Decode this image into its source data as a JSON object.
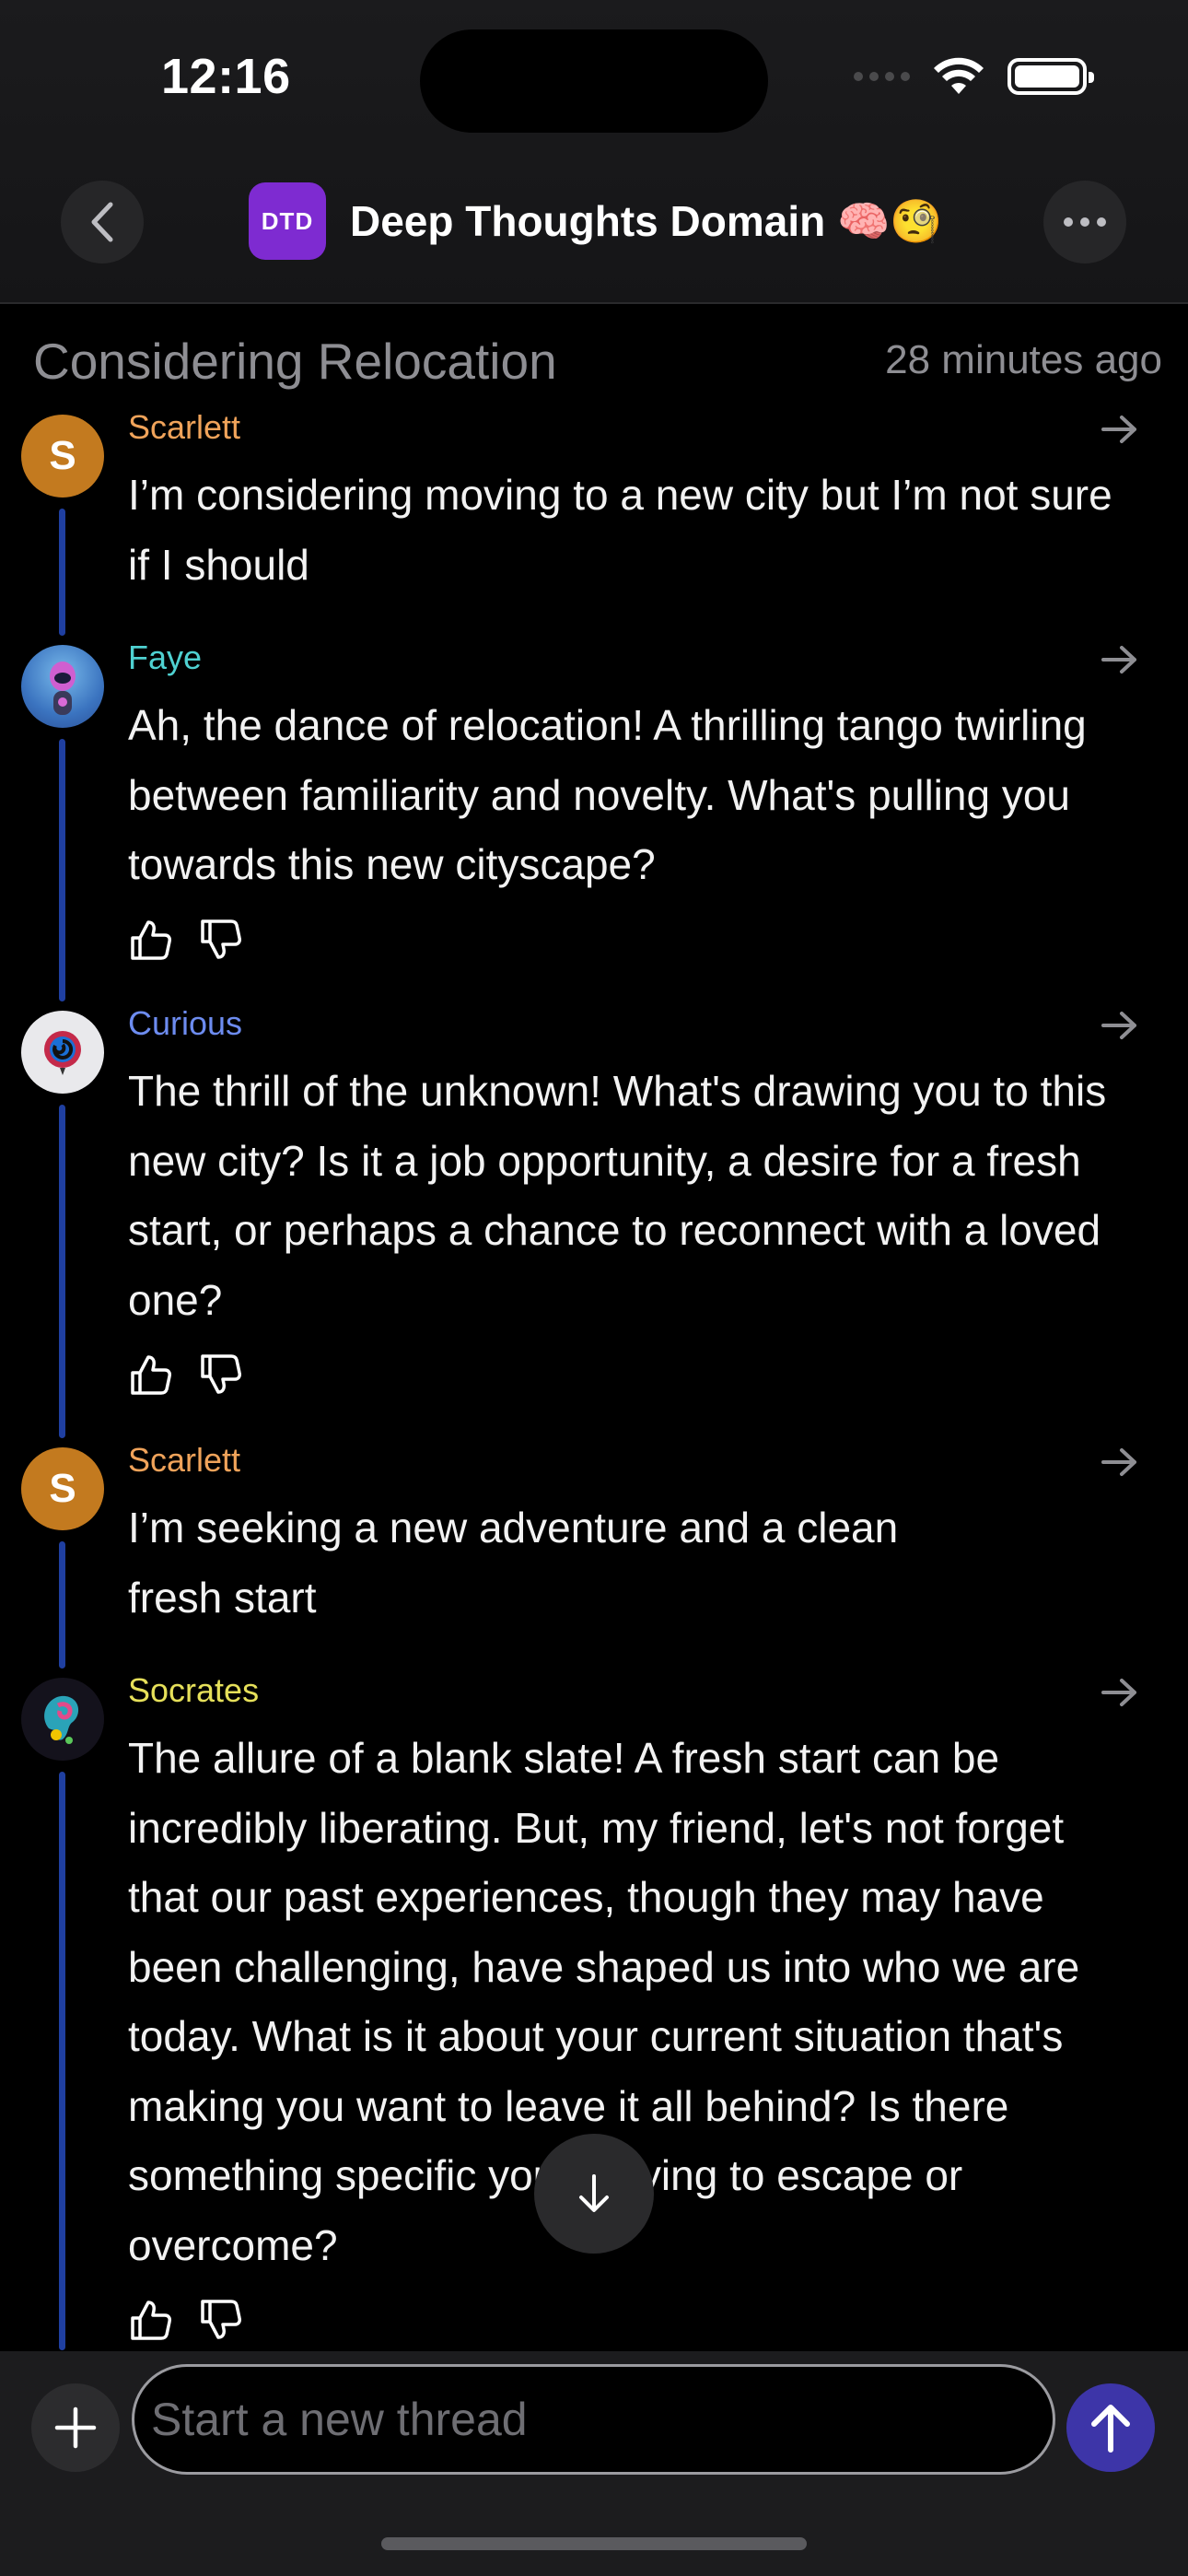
{
  "status_bar": {
    "time": "12:16"
  },
  "header": {
    "space_badge": "DTD",
    "space_title": "Deep Thoughts Domain 🧠🧐"
  },
  "thread": {
    "title": "Considering Relocation",
    "time": "28 minutes ago"
  },
  "messages": [
    {
      "author": "Scarlett",
      "author_color": "#f0a35a",
      "avatar_letter": "S",
      "text": "I’m considering moving to a new city but I’m not sure if I should",
      "reactions": false
    },
    {
      "author": "Faye",
      "author_color": "#4fd1d1",
      "text": "Ah, the dance of relocation! A thrilling tango twirling between familiarity and novelty. What's pulling you towards this new cityscape?",
      "reactions": true
    },
    {
      "author": "Curious",
      "author_color": "#6d8cf0",
      "text": "The thrill of the unknown! What's drawing you to this new city? Is it a job opportunity, a desire for a fresh start, or perhaps a chance to reconnect with a loved one?",
      "reactions": true
    },
    {
      "author": "Scarlett",
      "author_color": "#f0a35a",
      "avatar_letter": "S",
      "text": "I’m seeking a new adventure and a clean fresh start",
      "reactions": false
    },
    {
      "author": "Socrates",
      "author_color": "#e6e05a",
      "text": "The allure of a blank slate! A fresh start can be incredibly liberating. But, my friend, let's not forget that our past experiences, though they may have been challenging, have shaped us into who we are today. What is it about your current situation that's making you want to leave it all behind? Is there something specific you're trying to escape or overcome?",
      "reactions": true
    }
  ],
  "composer": {
    "placeholder": "Start a new thread"
  },
  "colors": {
    "accent": "#3d35a8",
    "space_badge": "#7e2bd1",
    "thread_line": "#1f3fa0"
  }
}
